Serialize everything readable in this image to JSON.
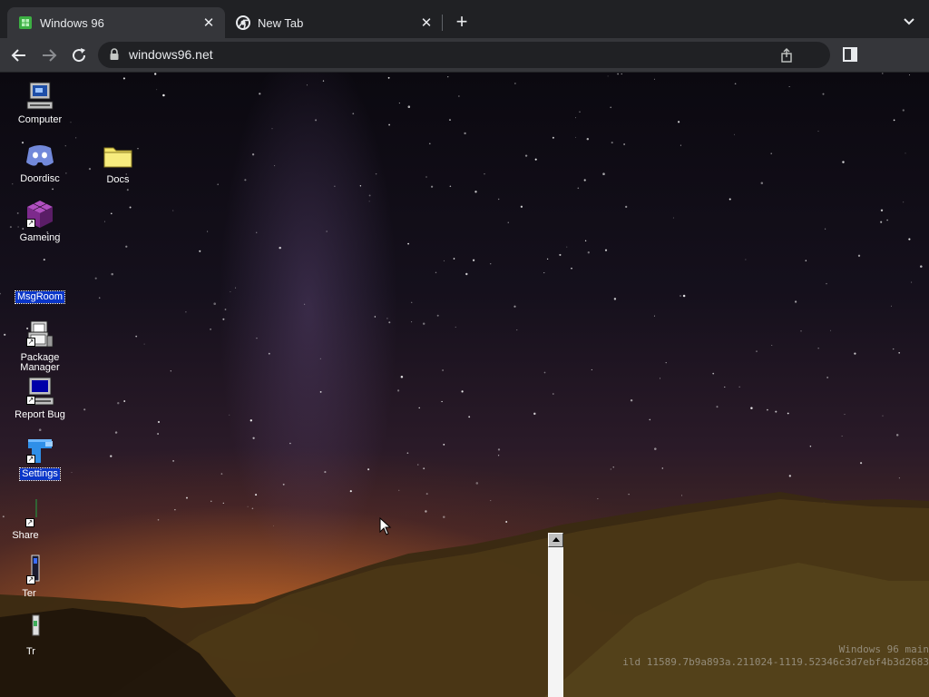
{
  "browser": {
    "tabs": [
      {
        "title": "Windows 96",
        "active": true,
        "favicon": "windows96-favicon"
      },
      {
        "title": "New Tab",
        "active": false,
        "favicon": "chrome-icon"
      }
    ],
    "new_tab_label": "+",
    "url": "windows96.net"
  },
  "desktop": {
    "icons": [
      {
        "label": "Computer",
        "icon": "computer-icon",
        "selected": false
      },
      {
        "label": "Doordisc",
        "icon": "discord-icon",
        "selected": false
      },
      {
        "label": "Gameing",
        "icon": "game-cube-icon",
        "selected": false
      },
      {
        "label": "MsgRoom",
        "icon": "msgroom-icon",
        "selected": true
      },
      {
        "label": "Package Manager",
        "icon": "package-manager-icon",
        "selected": false
      },
      {
        "label": "Report Bug",
        "icon": "report-bug-icon",
        "selected": false
      },
      {
        "label": "Settings",
        "icon": "settings-icon",
        "selected": true
      },
      {
        "label": "Share",
        "icon": "share-icon",
        "selected": false
      },
      {
        "label": "Ter",
        "icon": "terminal-icon",
        "selected": false
      },
      {
        "label": "Tr",
        "icon": "trash-icon",
        "selected": false
      },
      {
        "label": "Docs",
        "icon": "folder-icon",
        "selected": false
      }
    ],
    "watermark": {
      "line1": "Windows 96 main",
      "line2": "ild 11589.7b9a893a.211024-1119.52346c3d7ebf4b3d2683"
    }
  },
  "colors": {
    "chrome_dark": "#202124",
    "chrome_toolbar": "#35363a",
    "selection": "#0a36c8",
    "folder_yellow": "#f4e66a"
  }
}
